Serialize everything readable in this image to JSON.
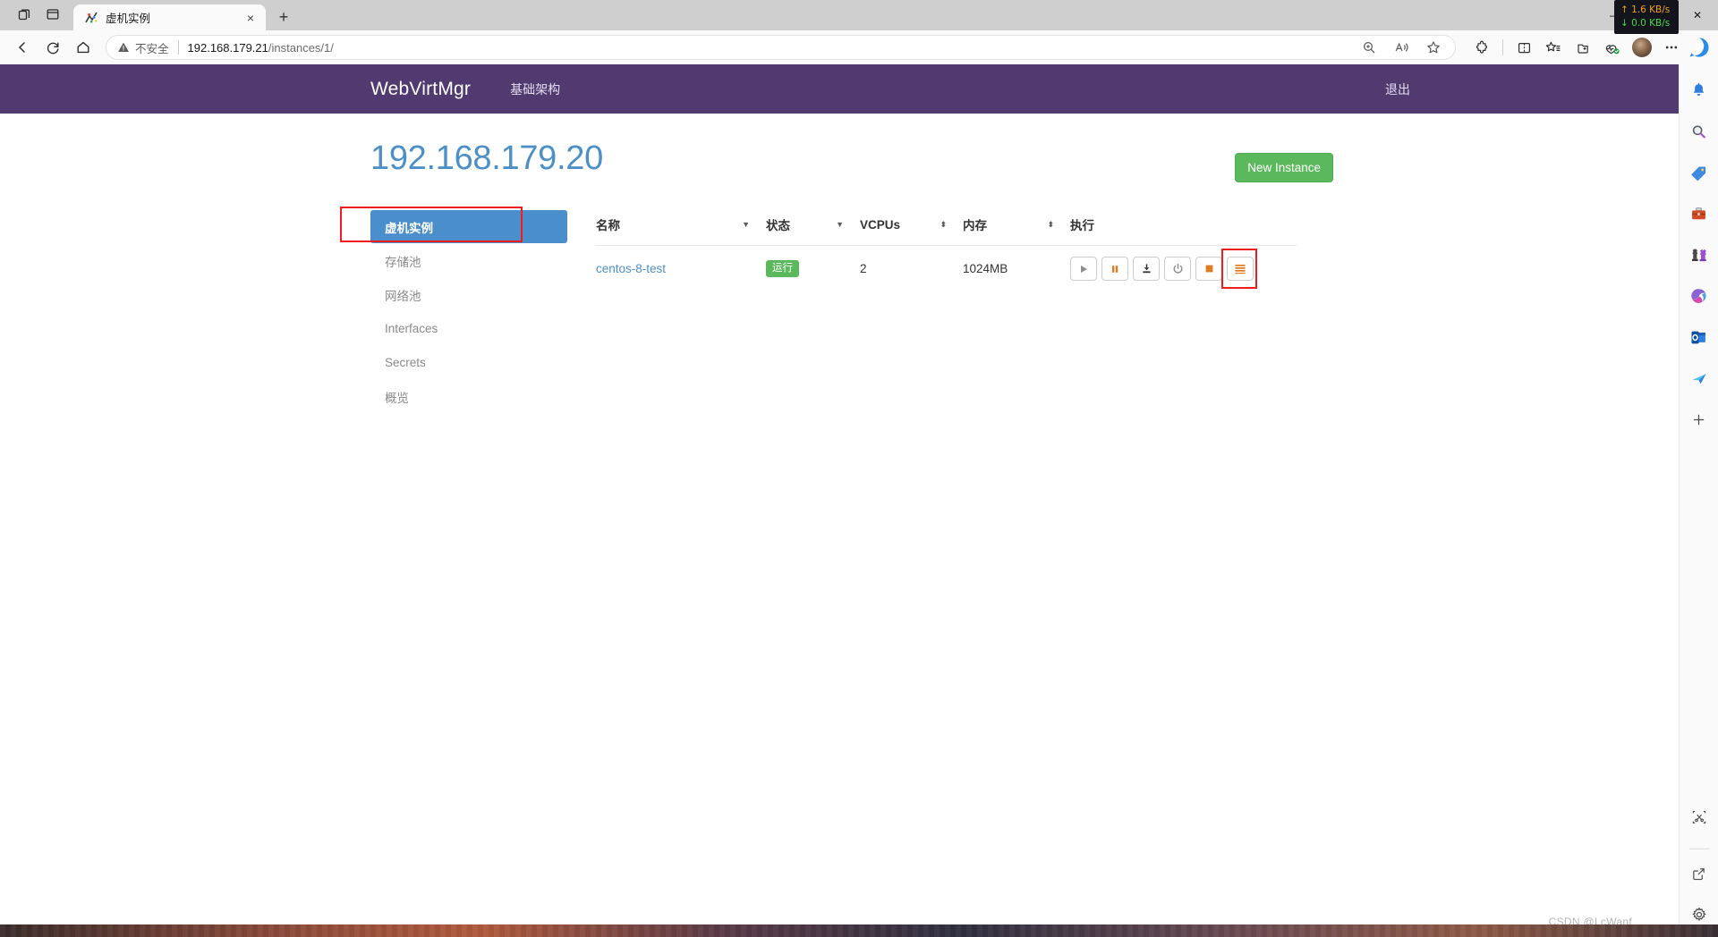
{
  "browser": {
    "tab": {
      "title": "虚机实例",
      "favicon": "chart-favicon",
      "close_label": "×"
    },
    "newtab_label": "+",
    "window_controls": {
      "minimize": "—",
      "maximize": "❐",
      "close": "✕"
    },
    "nav": {
      "back": "←",
      "refresh": "⟳",
      "home": "⌂"
    },
    "omnibox": {
      "security_text": "不安全",
      "url_host": "192.168.179.21",
      "url_path": "/instances/1/",
      "zoom_icon": "zoom-in-icon",
      "read_aloud_icon": "read-aloud-icon",
      "favorite_icon": "star-icon"
    },
    "extensions": [
      {
        "name": "puzzle-extensions-icon",
        "glyph": "⬡"
      },
      {
        "name": "split-screen-icon",
        "glyph": "▯"
      },
      {
        "name": "collections-icon",
        "glyph": "☆"
      },
      {
        "name": "add-tab-group-icon",
        "glyph": "⊕"
      },
      {
        "name": "browser-essentials-icon",
        "glyph": "♥"
      },
      {
        "name": "profile-avatar",
        "glyph": ""
      },
      {
        "name": "settings-more-icon",
        "glyph": "⋯"
      },
      {
        "name": "copilot-icon",
        "glyph": "b"
      }
    ],
    "sidebar": [
      {
        "name": "notifications-bell-icon",
        "glyph": "🔔"
      },
      {
        "name": "search-icon",
        "glyph": "🔍"
      },
      {
        "name": "shopping-tag-icon",
        "glyph": "🏷"
      },
      {
        "name": "tools-briefcase-icon",
        "glyph": "🧰"
      },
      {
        "name": "games-icon",
        "glyph": "♟"
      },
      {
        "name": "microsoft365-icon",
        "glyph": "◎"
      },
      {
        "name": "outlook-icon",
        "glyph": "📧"
      },
      {
        "name": "send-plane-icon",
        "glyph": "✈"
      },
      {
        "name": "add-sidebar-app-icon",
        "glyph": "+"
      }
    ],
    "sidebar_bottom": [
      {
        "name": "screenshot-scissors-icon",
        "glyph": "✂"
      },
      {
        "name": "open-in-new-icon",
        "glyph": "⧉"
      },
      {
        "name": "settings-gear-icon",
        "glyph": "⚙"
      }
    ]
  },
  "network_monitor": {
    "upload": "↑ 1.6 KB/s",
    "download": "↓ 0.0 KB/s",
    "upload_color": "#f0a020",
    "download_color": "#4ad84a"
  },
  "app": {
    "brand": "WebVirtMgr",
    "nav_link": "基础架构",
    "logout": "退出",
    "navbar_color": "#513a70"
  },
  "page": {
    "title": "192.168.179.20",
    "title_color": "#4d90c8",
    "new_instance_label": "New Instance",
    "new_instance_color": "#5cb85c"
  },
  "sidenav": {
    "items": [
      {
        "label": "虚机实例",
        "active": true
      },
      {
        "label": "存储池",
        "active": false
      },
      {
        "label": "网络池",
        "active": false
      },
      {
        "label": "Interfaces",
        "active": false
      },
      {
        "label": "Secrets",
        "active": false
      },
      {
        "label": "概览",
        "active": false
      }
    ],
    "active_color": "#4a8fcc",
    "highlight_color": "#f01d1d"
  },
  "table": {
    "headers": [
      {
        "label": "名称",
        "sort": "▼"
      },
      {
        "label": "状态",
        "sort": "▼"
      },
      {
        "label": "VCPUs",
        "sort": "⬍"
      },
      {
        "label": "内存",
        "sort": "⬍"
      },
      {
        "label": "执行",
        "sort": ""
      }
    ],
    "rows": [
      {
        "name": "centos-8-test",
        "status": "运行",
        "status_color": "#5cb85c",
        "vcpus": "2",
        "memory": "1024MB",
        "actions": [
          {
            "name": "start-button",
            "glyph": "▶",
            "color": "#888888"
          },
          {
            "name": "pause-button",
            "glyph": "❚❚",
            "color": "#e07b20"
          },
          {
            "name": "snapshot-button",
            "glyph": "⤓",
            "color": "#333333"
          },
          {
            "name": "power-off-button",
            "glyph": "⏻",
            "color": "#888888"
          },
          {
            "name": "force-stop-button",
            "glyph": "■",
            "color": "#e07b20"
          },
          {
            "name": "console-menu-button",
            "glyph": "≡",
            "color": "#e07b20"
          }
        ]
      }
    ]
  },
  "watermark": "CSDN @LcWanf"
}
